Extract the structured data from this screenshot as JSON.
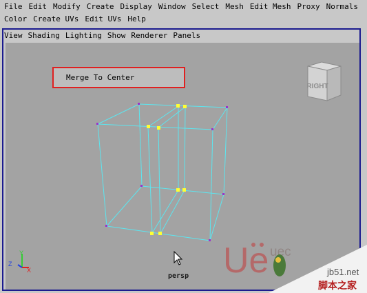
{
  "main_menu": {
    "row1": [
      "File",
      "Edit",
      "Modify",
      "Create",
      "Display",
      "Window",
      "Select",
      "Mesh",
      "Edit Mesh",
      "Proxy",
      "Normals"
    ],
    "row2": [
      "Color",
      "Create UVs",
      "Edit UVs",
      "Help"
    ]
  },
  "panel_menu": [
    "View",
    "Shading",
    "Lighting",
    "Show",
    "Renderer",
    "Panels"
  ],
  "merge": {
    "label": "Merge To Center"
  },
  "viewcube": {
    "label": "RIGHT"
  },
  "camera": {
    "name": "persp"
  },
  "axis": {
    "x": "X",
    "y": "Y",
    "z": "Z"
  },
  "watermark": {
    "ue_logo": "Ue",
    "ueq": "uec",
    "site": "jb51.net",
    "site_cn": "脚本之家"
  },
  "colors": {
    "wire": "#5ce6f0",
    "vertex_selected": "#ffff33",
    "vertex": "#9933cc",
    "highlight": "#e02020",
    "frame": "#1b1b8f"
  }
}
